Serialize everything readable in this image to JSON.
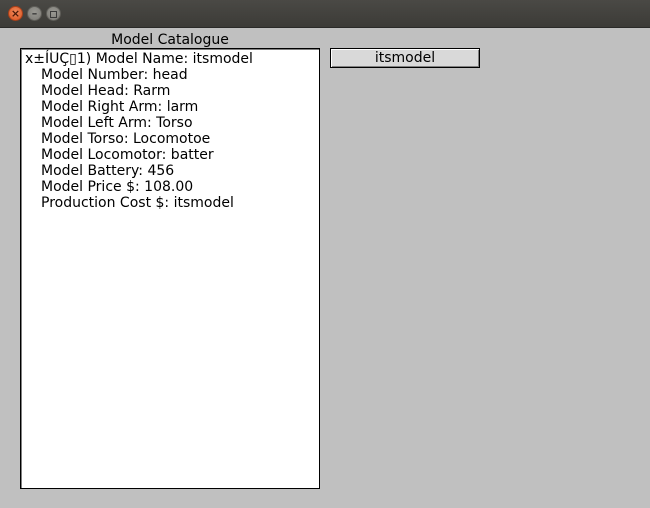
{
  "window": {
    "close_glyph": "×",
    "minimize_glyph": "–",
    "maximize_glyph": ""
  },
  "catalogue": {
    "title": "Model Catalogue",
    "entry": {
      "line_1": "x±ÍUÇ▯1) Model Name: itsmodel",
      "model_number": "Model Number: head",
      "model_head": "Model Head: Rarm",
      "model_right_arm": "Model Right Arm: larm",
      "model_left_arm": "Model Left Arm: Torso",
      "model_torso": "Model Torso: Locomotoe",
      "model_locomotor": "Model Locomotor: batter",
      "model_battery": "Model Battery: 456",
      "model_price": "Model Price $: 108.00",
      "production_cost": "Production Cost $: itsmodel"
    }
  },
  "actions": {
    "model_button_label": "itsmodel"
  }
}
